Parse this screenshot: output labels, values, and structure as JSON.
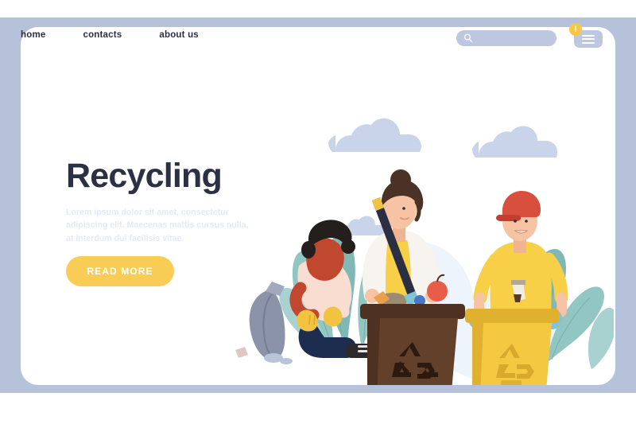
{
  "page": {
    "frame_color": "#b6c1da",
    "card_color": "#ffffff"
  },
  "nav": {
    "items": [
      {
        "label": "home"
      },
      {
        "label": "contacts"
      },
      {
        "label": "about us"
      }
    ]
  },
  "header": {
    "search": {
      "value": "",
      "placeholder": "",
      "icon": "search-icon",
      "background": "#bdc8e0"
    },
    "menu_button": {
      "icon": "hamburger-menu-icon",
      "background": "#bdc8e0"
    },
    "notification_badge": {
      "text": "!",
      "color": "#f9c648"
    }
  },
  "hero": {
    "title": "Recycling",
    "title_color": "#2b3044",
    "body": "Lorem ipsum dolor sit amet, consectetur adipiscing elit. Maecenas mattis cursus nulla, at interdum dui facilisis vitae.",
    "body_color": "#e3e9f5",
    "cta_label": "READ MORE",
    "cta_color": "#f9cc56"
  },
  "illustration": {
    "name": "recycling-scene",
    "colors": {
      "foliage_dark": "#7fb8b4",
      "foliage_mid": "#93c6c2",
      "foliage_light": "#b8dcd9",
      "cloud": "#c9d4ea",
      "bin_brown": "#63402a",
      "bin_brown_dark": "#4e3120",
      "bin_yellow": "#f5c842",
      "bin_yellow_dark": "#e0b02f",
      "skin_light": "#f6c3a4",
      "skin_dark": "#c0482f",
      "shirt_yellow": "#f7d047",
      "coat_white": "#f7f3ee",
      "shirt_pink": "#f9ddd0",
      "pants_navy": "#1d2d50",
      "glove_blue": "#7fc5d6",
      "glove_yellow": "#f2c341",
      "cap_red": "#d94f3d",
      "hair_brown": "#4a3226",
      "hair_black": "#241f1d",
      "bag_gray": "#8a93a8",
      "boot_brown": "#8a5a34"
    },
    "elements": [
      {
        "name": "woman-worker",
        "description": "woman with bun, white coat, yellow shirt, holding litter picker and apple"
      },
      {
        "name": "man-worker",
        "description": "man with red cap, yellow t-shirt, blue gloves, navy pants"
      },
      {
        "name": "crouching-worker",
        "description": "person crouching with afro hair, pink top, yellow gloves, holding gray trash bag"
      },
      {
        "name": "brown-recycling-bin",
        "description": "brown wheeled bin with recycling symbol"
      },
      {
        "name": "yellow-recycling-bin",
        "description": "yellow wheeled bin with recycling symbol"
      },
      {
        "name": "clouds",
        "description": "three light blue clouds"
      },
      {
        "name": "foliage",
        "description": "teal tropical leaves and bushes"
      }
    ]
  }
}
